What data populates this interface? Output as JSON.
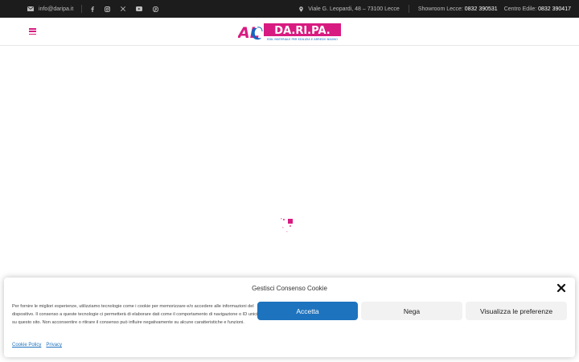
{
  "topbar": {
    "email": "info@daripa.it",
    "social_icons": [
      "facebook-icon",
      "instagram-icon",
      "x-icon",
      "youtube-icon",
      "pinterest-icon"
    ],
    "address": "Viale G. Leopardi, 48 – 73100 Lecce",
    "showroom_label": "Showroom Lecce:",
    "showroom_phone": "0832 390531",
    "edile_label": "Centro Edile:",
    "edile_phone": "0832 390417"
  },
  "header": {
    "logo_prefix": "AL",
    "logo_name": "DA.RI.PA.",
    "logo_tagline": "EDIL MATERIALE PER EDILIZIA E ARREDO BAGNO"
  },
  "colors": {
    "brand_magenta": "#d81b80",
    "brand_blue": "#1565c0",
    "accept_blue": "#1e73be",
    "topbar_bg": "#1c1c1c"
  },
  "cookie": {
    "title": "Gestisci Consenso Cookie",
    "text": "Per fornire le migliori esperienze, utilizziamo tecnologie come i cookie per memorizzare e/o accedere alle informazioni del dispositivo. Il consenso a queste tecnologie ci permetterà di elaborare dati come il comportamento di navigazione o ID unici su questo sito. Non acconsentire o ritirare il consenso può influire negativamente su alcune caratteristiche e funzioni.",
    "accept": "Accetta",
    "deny": "Nega",
    "preferences": "Visualizza le preferenze",
    "link_policy": "Cookie Policy",
    "link_privacy": "Privacy"
  }
}
